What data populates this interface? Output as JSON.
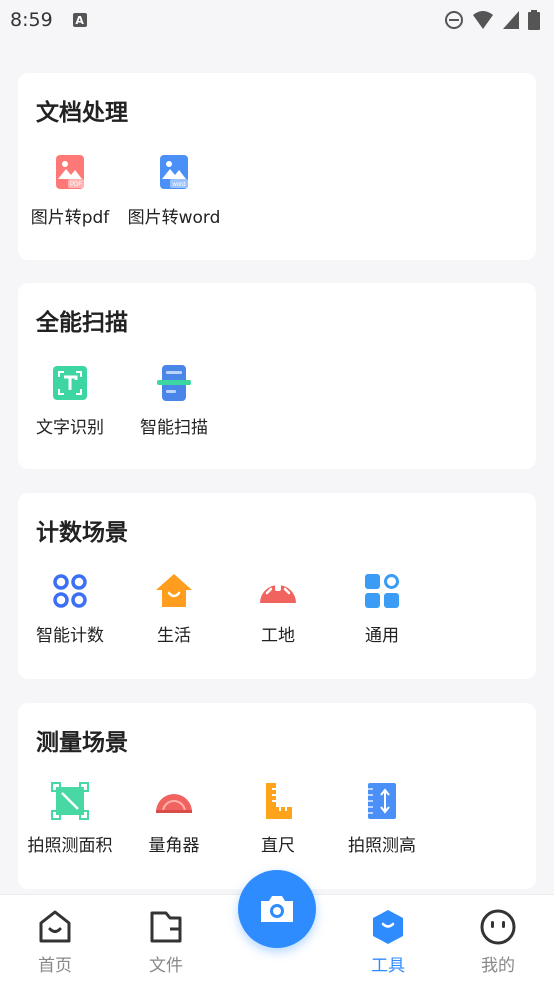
{
  "status_bar": {
    "time": "8:59",
    "a_badge": "A"
  },
  "sections": [
    {
      "title": "文档处理",
      "tools": [
        {
          "label": "图片转pdf",
          "icon": "image-pdf-icon"
        },
        {
          "label": "图片转word",
          "icon": "image-word-icon"
        }
      ]
    },
    {
      "title": "全能扫描",
      "tools": [
        {
          "label": "文字识别",
          "icon": "text-recognition-icon"
        },
        {
          "label": "智能扫描",
          "icon": "smart-scan-icon"
        }
      ]
    },
    {
      "title": "计数场景",
      "tools": [
        {
          "label": "智能计数",
          "icon": "smart-count-icon"
        },
        {
          "label": "生活",
          "icon": "home-icon"
        },
        {
          "label": "工地",
          "icon": "hard-hat-icon"
        },
        {
          "label": "通用",
          "icon": "grid-apps-icon"
        }
      ]
    },
    {
      "title": "测量场景",
      "tools": [
        {
          "label": "拍照测面积",
          "icon": "area-measure-icon"
        },
        {
          "label": "量角器",
          "icon": "protractor-icon"
        },
        {
          "label": "直尺",
          "icon": "ruler-icon"
        },
        {
          "label": "拍照测高",
          "icon": "height-measure-icon"
        }
      ]
    }
  ],
  "tabs": [
    {
      "label": "首页",
      "icon": "home-tab-icon",
      "active": false
    },
    {
      "label": "文件",
      "icon": "folder-icon",
      "active": false
    },
    {
      "label": "工具",
      "icon": "tools-cube-icon",
      "active": true
    },
    {
      "label": "我的",
      "icon": "profile-face-icon",
      "active": false
    }
  ],
  "colors": {
    "accent": "#2f8cff",
    "pdf": "#ff6b6b",
    "word": "#4a90f7",
    "green": "#34d399",
    "orange": "#ff9d1f",
    "red": "#f0635f"
  }
}
